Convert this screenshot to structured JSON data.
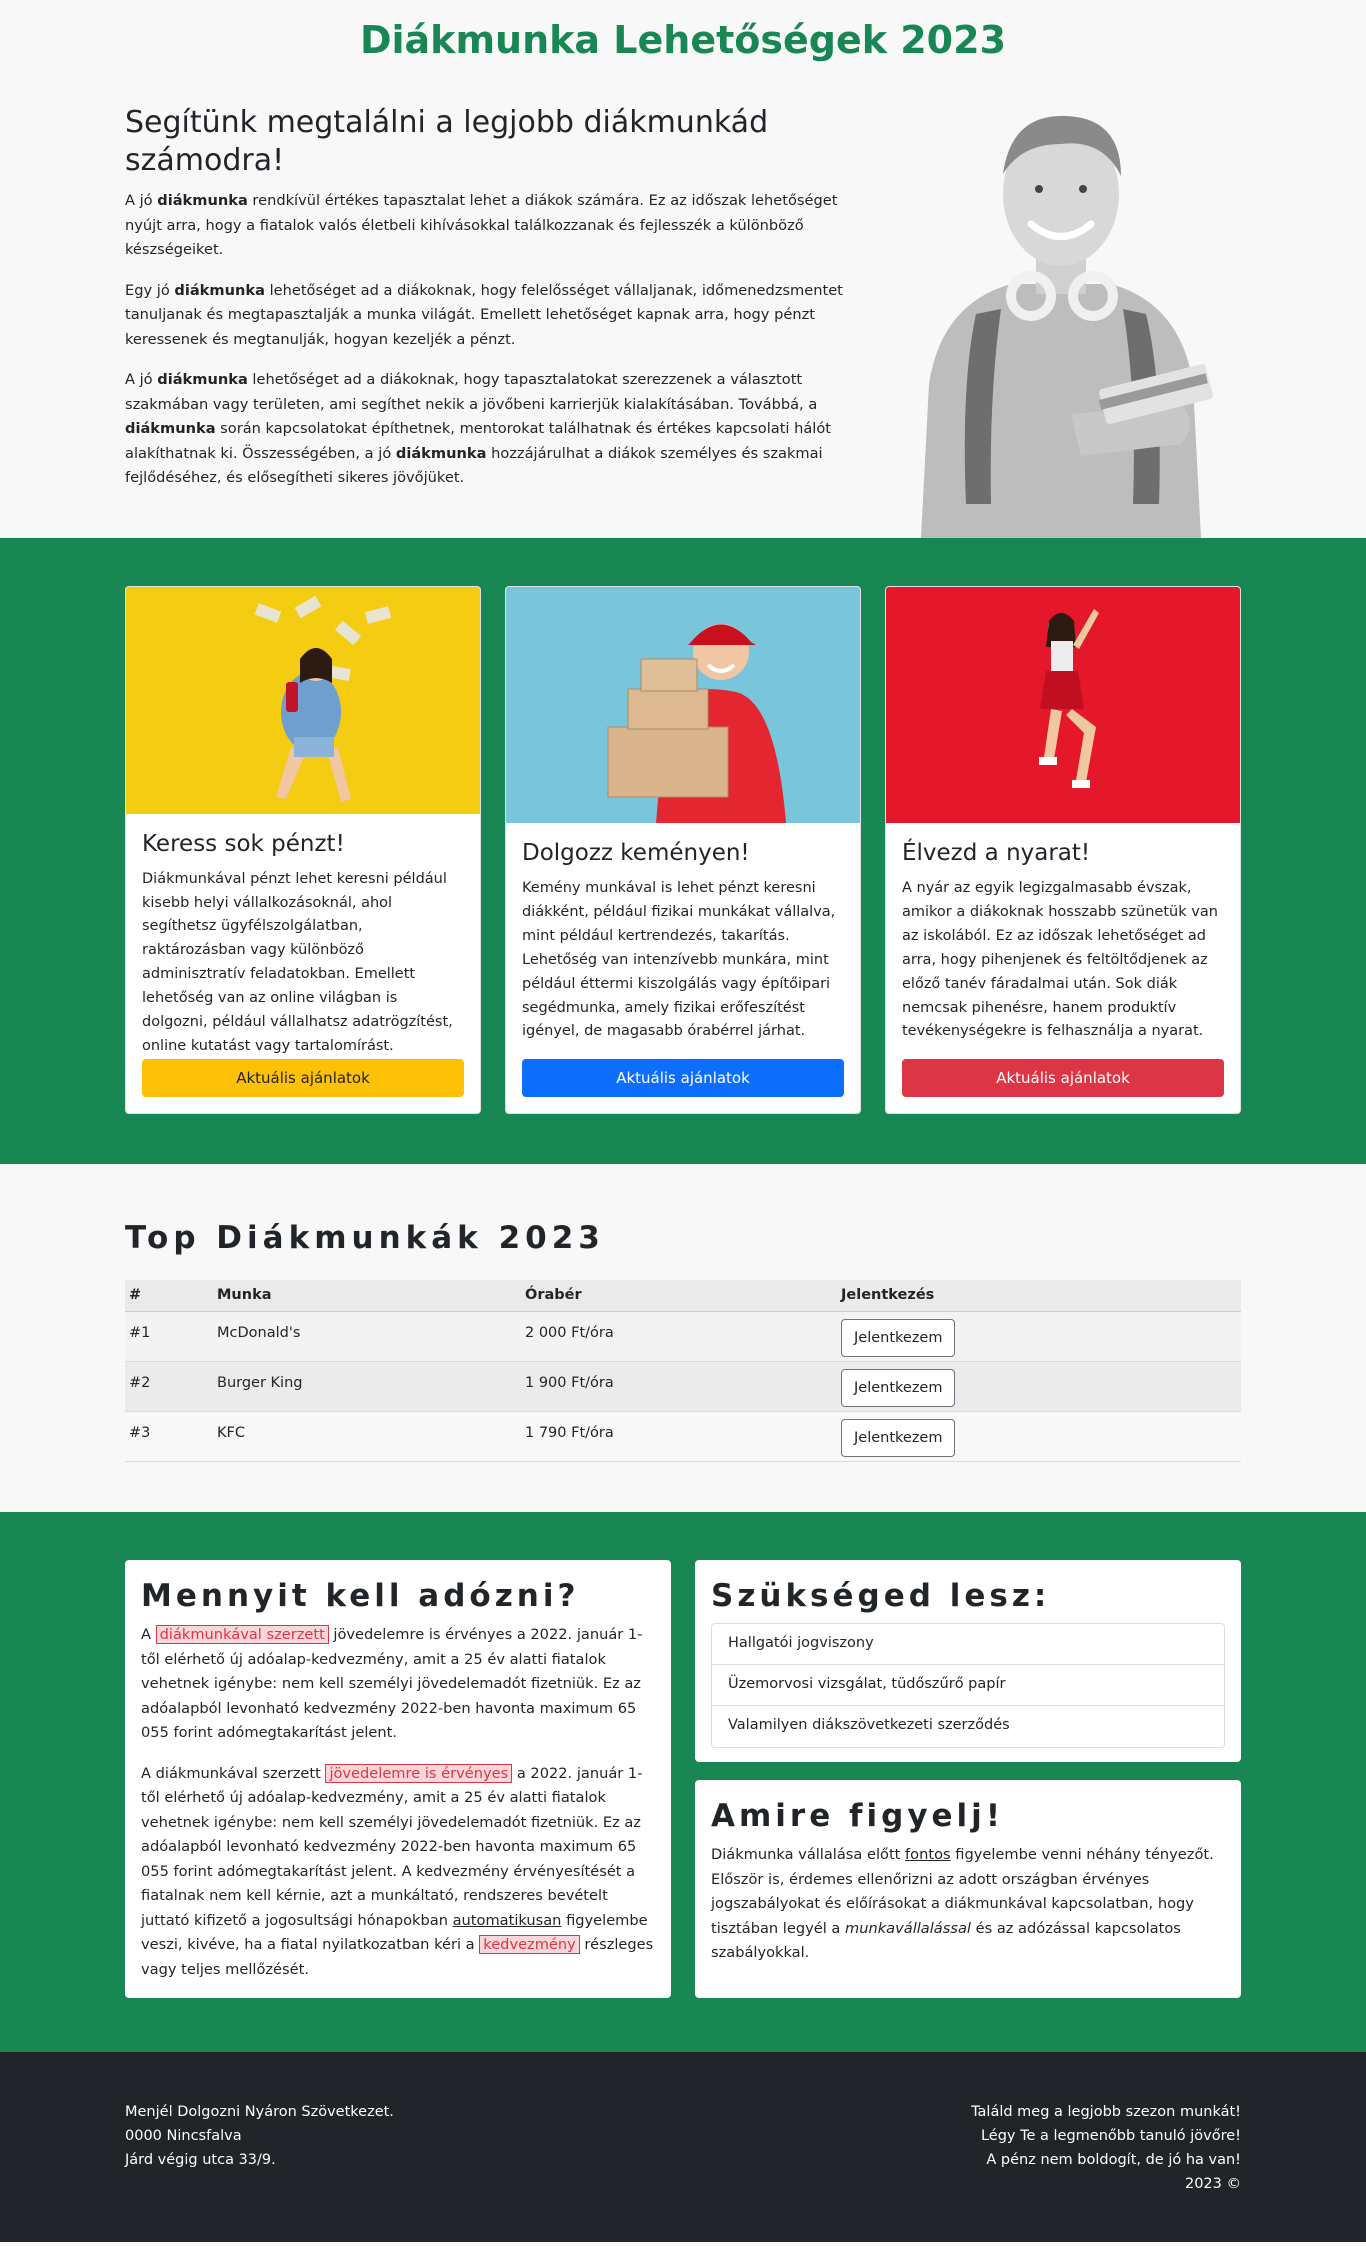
{
  "header": {
    "title": "Diákmunka Lehetőségek 2023"
  },
  "intro": {
    "heading": "Segítünk megtalálni a legjobb diákmunkád számodra!",
    "p1": [
      {
        "t": "A jó "
      },
      {
        "b": "diákmunka"
      },
      {
        "t": " rendkívül értékes tapasztalat lehet a diákok számára. Ez az időszak lehetőséget nyújt arra, hogy a fiatalok valós életbeli kihívásokkal találkozzanak és fejlesszék a különböző készségeiket."
      }
    ],
    "p2": [
      {
        "t": "Egy jó "
      },
      {
        "b": "diákmunka"
      },
      {
        "t": " lehetőséget ad a diákoknak, hogy felelősséget vállaljanak, időmenedzsmentet tanuljanak és megtapasztalják a munka világát. Emellett lehetőséget kapnak arra, hogy pénzt keressenek és megtanulják, hogyan kezeljék a pénzt."
      }
    ],
    "p3": [
      {
        "t": "A jó "
      },
      {
        "b": "diákmunka"
      },
      {
        "t": " lehetőséget ad a diákoknak, hogy tapasztalatokat szerezzenek a választott szakmában vagy területen, ami segíthet nekik a jövőbeni karrierjük kialakításában. Továbbá, a "
      },
      {
        "b": "diákmunka"
      },
      {
        "t": " során kapcsolatokat építhetnek, mentorokat találhatnak és értékes kapcsolati hálót alakíthatnak ki. Összességében, a jó "
      },
      {
        "b": "diákmunka"
      },
      {
        "t": " hozzájárulhat a diákok személyes és szakmai fejlődéséhez, és elősegítheti sikeres jövőjüket."
      }
    ]
  },
  "cards": [
    {
      "title": "Keress sok pénzt!",
      "text": "Diákmunkával pénzt lehet keresni például kisebb helyi vállalkozásoknál, ahol segíthetsz ügyfélszolgálatban, raktározásban vagy különböző adminisztratív feladatokban. Emellett lehetőség van az online világban is dolgozni, például vállalhatsz adatrögzítést, online kutatást vagy tartalomírást.",
      "button": "Aktuális ajánlatok",
      "btn_color": "#ffc107",
      "btn_text_color": "#212529",
      "img_bg": "#f4cc12"
    },
    {
      "title": "Dolgozz keményen!",
      "text": "Kemény munkával is lehet pénzt keresni diákként, például fizikai munkákat vállalva, mint például kertrendezés, takarítás. Lehetőség van intenzívebb munkára, mint például éttermi kiszolgálás vagy építőipari segédmunka, amely fizikai erőfeszítést igényel, de magasabb órabérrel járhat.",
      "button": "Aktuális ajánlatok",
      "btn_color": "#0d6efd",
      "btn_text_color": "#ffffff",
      "img_bg": "#79c5dc"
    },
    {
      "title": "Élvezd a nyarat!",
      "text": "A nyár az egyik legizgalmasabb évszak, amikor a diákoknak hosszabb szünetük van az iskolából. Ez az időszak lehetőséget ad arra, hogy pihenjenek és feltöltődjenek az előző tanév fáradalmai után. Sok diák nemcsak pihenésre, hanem produktív tevékenységekre is felhasználja a nyarat.",
      "button": "Aktuális ajánlatok",
      "btn_color": "#dc3545",
      "btn_text_color": "#ffffff",
      "img_bg": "#e5172a"
    }
  ],
  "top_jobs": {
    "heading": "Top Diákmunkák 2023",
    "columns": [
      "#",
      "Munka",
      "Órabér",
      "Jelentkezés"
    ],
    "rows": [
      {
        "rank": "#1",
        "job": "McDonald's",
        "wage": "2 000 Ft/óra",
        "button": "Jelentkezem"
      },
      {
        "rank": "#2",
        "job": "Burger King",
        "wage": "1 900 Ft/óra",
        "button": "Jelentkezem"
      },
      {
        "rank": "#3",
        "job": "KFC",
        "wage": "1 790 Ft/óra",
        "button": "Jelentkezem"
      }
    ]
  },
  "tax": {
    "heading": "Mennyit kell adózni?",
    "p1": [
      {
        "t": "A "
      },
      {
        "hl": "diákmunkával szerzett"
      },
      {
        "t": " jövedelemre is érvényes a 2022. január 1-től elérhető új adóalap-kedvezmény, amit a 25 év alatti fiatalok vehetnek igénybe: nem kell személyi jövedelemadót fizetniük. Ez az adóalapból levonható kedvezmény 2022-ben havonta maximum 65 055 forint adómegtakarítást jelent."
      }
    ],
    "p2": [
      {
        "t": "A diákmunkával szerzett "
      },
      {
        "hl": "jövedelemre is érvényes"
      },
      {
        "t": " a 2022. január 1-től elérhető új adóalap-kedvezmény, amit a 25 év alatti fiatalok vehetnek igénybe: nem kell személyi jövedelemadót fizetniük. Ez az adóalapból levonható kedvezmény 2022-ben havonta maximum 65 055 forint adómegtakarítást jelent. A kedvezmény érvényesítését a fiatalnak nem kell kérnie, azt a munkáltató, rendszeres bevételt juttató kifizető a jogosultsági hónapokban "
      },
      {
        "u": "automatikusan"
      },
      {
        "t": " figyelembe veszi, kivéve, ha a fiatal nyilatkozatban kéri a "
      },
      {
        "hl": "kedvezmény"
      },
      {
        "t": " részleges vagy teljes mellőzését."
      }
    ]
  },
  "needs": {
    "heading": "Szükséged lesz:",
    "items": [
      "Hallgatói jogviszony",
      "Üzemorvosi vizsgálat, tüdőszűrő papír",
      "Valamilyen diákszövetkezeti szerződés"
    ]
  },
  "watch": {
    "heading": "Amire figyelj!",
    "p": [
      {
        "t": "Diákmunka vállalása előtt "
      },
      {
        "u": "fontos"
      },
      {
        "t": " figyelembe venni néhány tényezőt. Először is, érdemes ellenőrizni az adott országban érvényes jogszabályokat és előírásokat a diákmunkával kapcsolatban, hogy tisztában legyél a "
      },
      {
        "i": "munkavállalással"
      },
      {
        "t": " és az adózással kapcsolatos szabályokkal."
      }
    ]
  },
  "footer": {
    "left": [
      "Menjél Dolgozni Nyáron Szövetkezet.",
      "0000 Nincsfalva",
      "Járd végig utca 33/9."
    ],
    "right": [
      "Találd meg a legjobb szezon munkát!",
      "Légy Te a legmenőbb tanuló jövőre!",
      "A pénz nem boldogít, de jó ha van!",
      "2023 ©"
    ]
  },
  "colors": {
    "brand_green": "#198754",
    "footer_bg": "#212529",
    "highlight": "#dc3545"
  },
  "icons": [
    "hero-student-photo",
    "card-photo-money",
    "card-photo-boxes",
    "card-photo-summer"
  ]
}
